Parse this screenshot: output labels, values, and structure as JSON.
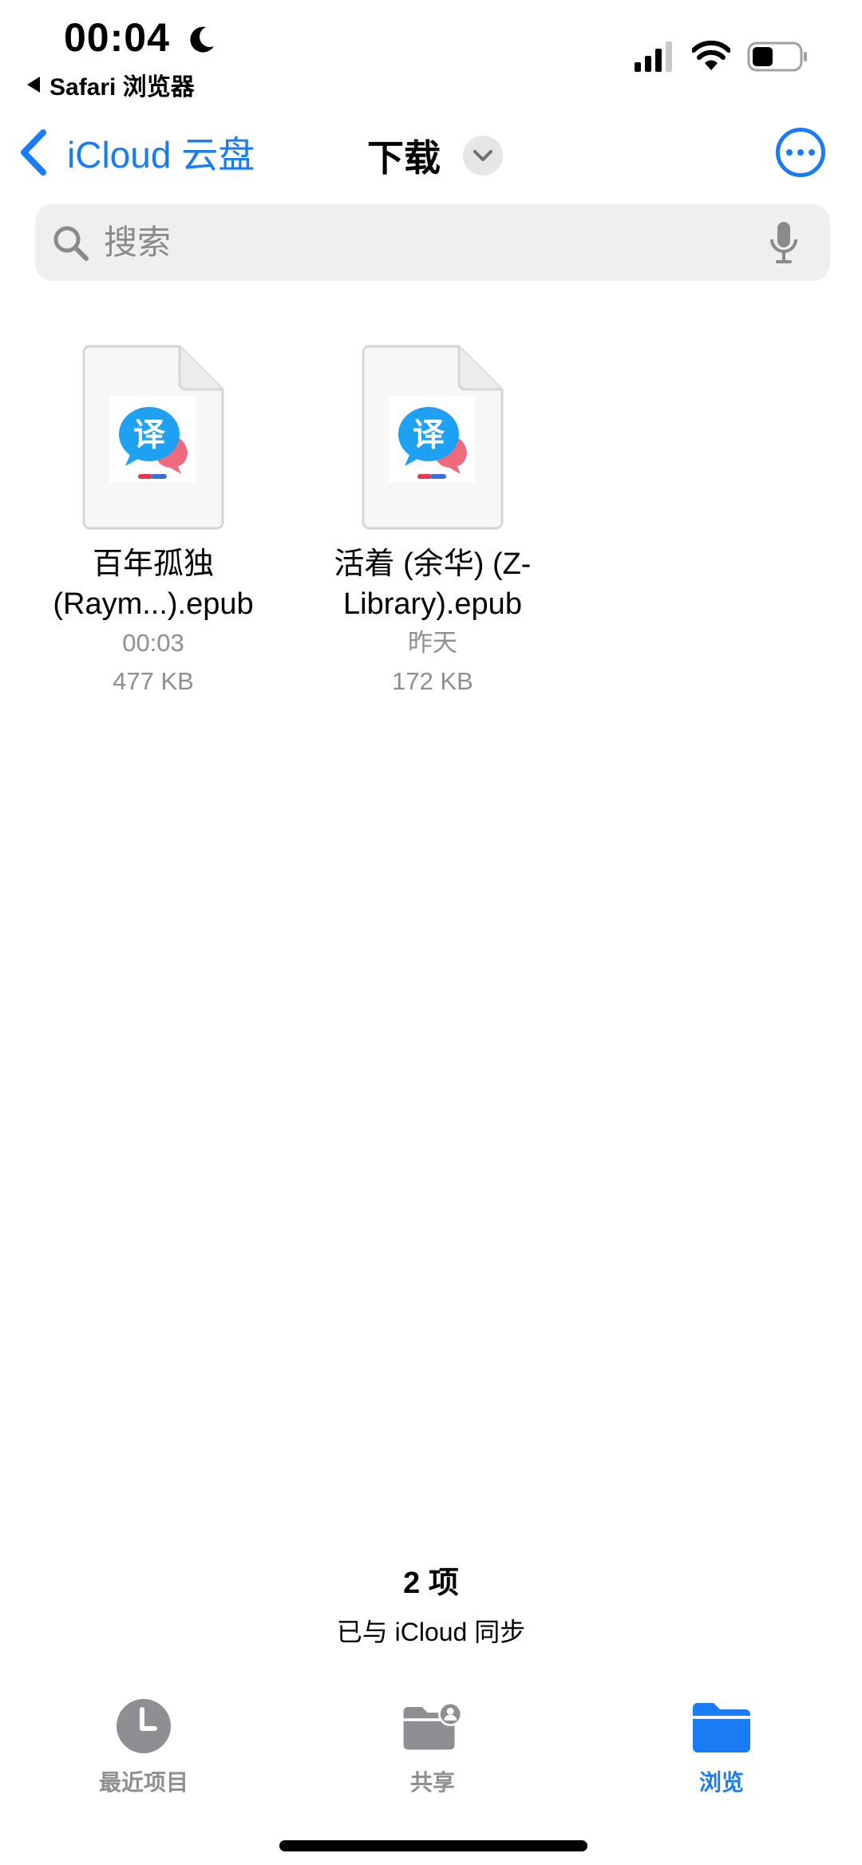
{
  "status_bar": {
    "time": "00:04",
    "back_app": "Safari 浏览器",
    "battery_level": 0.45
  },
  "nav": {
    "back_label": "iCloud 云盘",
    "title": "下载"
  },
  "search": {
    "placeholder": "搜索"
  },
  "files": [
    {
      "name_line1": "百年孤独",
      "name_line2": "(Raym...).epub",
      "date": "00:03",
      "size": "477 KB",
      "icon": "translate-app-icon"
    },
    {
      "name_line1": "活着 (余华) (Z-",
      "name_line2": "Library).epub",
      "date": "昨天",
      "size": "172 KB",
      "icon": "translate-app-icon"
    }
  ],
  "footer": {
    "count": "2 项",
    "sync_status": "已与 iCloud 同步"
  },
  "tabs": [
    {
      "label": "最近项目",
      "icon": "clock-icon"
    },
    {
      "label": "共享",
      "icon": "shared-folder-icon"
    },
    {
      "label": "浏览",
      "icon": "folder-icon"
    }
  ],
  "colors": {
    "accent": "#1a7cf5",
    "secondary_text": "#8e8e93",
    "search_bg": "#efeff0"
  }
}
